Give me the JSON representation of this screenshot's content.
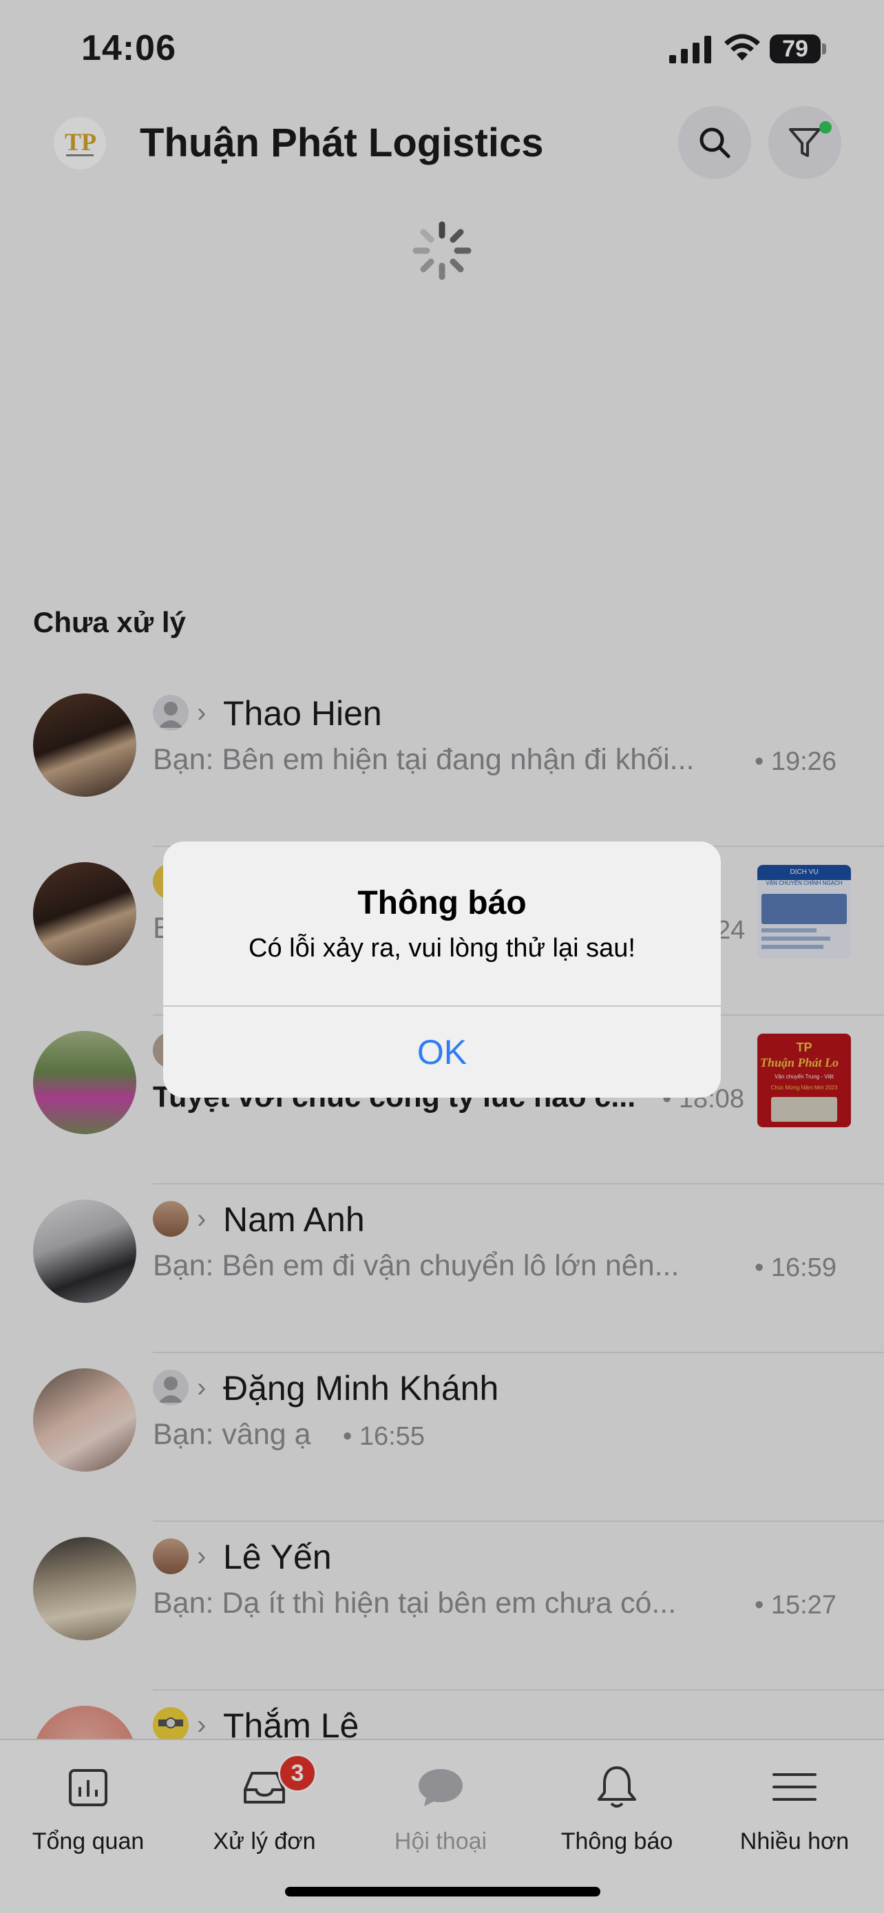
{
  "status_bar": {
    "time": "14:06",
    "battery": "79"
  },
  "header": {
    "title": "Thuận Phát Logistics",
    "logo_letters": "TP"
  },
  "section": {
    "title": "Chưa xử lý"
  },
  "conversations": [
    {
      "name": "Thao Hien",
      "preview": "Bạn:  Bên em hiện tại đang nhận đi khối...",
      "time": "• 19:26"
    },
    {
      "name": "",
      "preview": "B",
      "time": "24"
    },
    {
      "name": "",
      "preview": "Tuyệt vời chúc công ty lúc nào c...",
      "time": "• 18:08"
    },
    {
      "name": "Nam Anh",
      "preview": "Bạn:  Bên em đi vận chuyển lô lớn nên...",
      "time": "• 16:59"
    },
    {
      "name": "Đặng Minh Khánh",
      "preview": "Bạn:  vâng ạ",
      "time": "• 16:55"
    },
    {
      "name": "Lê Yến",
      "preview": "Bạn:  Dạ ít thì hiện tại bên em chưa có...",
      "time": "• 15:27"
    },
    {
      "name": "Thắm Lê",
      "preview": "",
      "time": ""
    }
  ],
  "thumbs": {
    "t1_header": "DỊCH VỤ",
    "t1_title": "VẬN CHUYỂN CHÍNH NGẠCH",
    "t2_title": "Thuận Phát Lo",
    "t2_sub": "Vận chuyển Trung - Việt",
    "t2_greeting": "Chúc Mừng Năm Mới 2023"
  },
  "tabs": [
    {
      "label": "Tổng quan",
      "icon": "chart-icon"
    },
    {
      "label": "Xử lý đơn",
      "icon": "inbox-icon",
      "badge": "3"
    },
    {
      "label": "Hội thoại",
      "icon": "chat-bubble-icon"
    },
    {
      "label": "Thông báo",
      "icon": "bell-icon"
    },
    {
      "label": "Nhiều hơn",
      "icon": "menu-icon"
    }
  ],
  "alert": {
    "title": "Thông báo",
    "message": "Có lỗi xảy ra, vui lòng thử lại sau!",
    "ok_label": "OK"
  },
  "colors": {
    "accent": "#2f7cf6",
    "badge": "#e5332a",
    "online_dot": "#34c759"
  }
}
